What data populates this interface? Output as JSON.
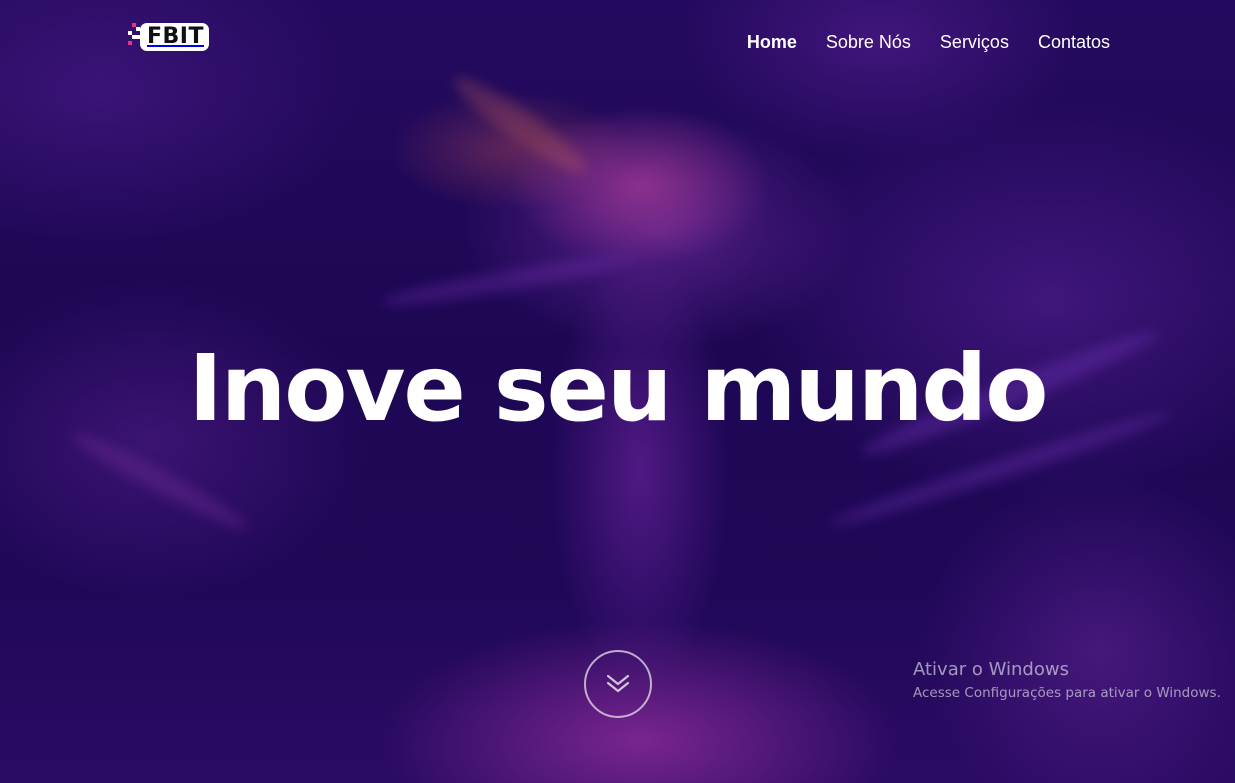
{
  "header": {
    "logo_text": "FBIT",
    "nav": [
      {
        "label": "Home",
        "active": true
      },
      {
        "label": "Sobre Nós",
        "active": false
      },
      {
        "label": "Serviços",
        "active": false
      },
      {
        "label": "Contatos",
        "active": false
      }
    ]
  },
  "hero": {
    "headline": "Inove seu mundo",
    "scroll_icon": "chevron-double-down-icon"
  },
  "windows_activation": {
    "title": "Ativar o Windows",
    "subtitle": "Acesse Configurações para ativar o Windows."
  },
  "colors": {
    "background": "#1d0753",
    "accent_pink": "#e0338c",
    "text": "#ffffff"
  }
}
